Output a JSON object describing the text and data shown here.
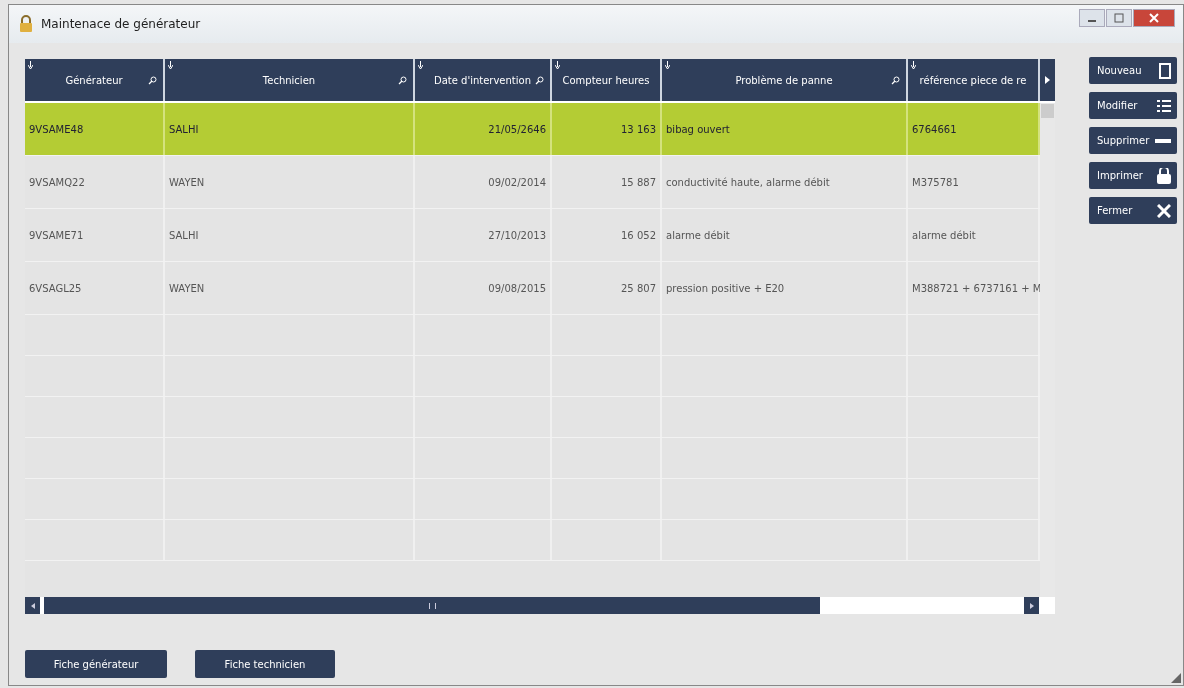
{
  "window": {
    "title": "Maintenace de générateur"
  },
  "table": {
    "columns": [
      {
        "label": "Générateur",
        "kind": "text",
        "filter": true
      },
      {
        "label": "Technicien",
        "kind": "text",
        "filter": true
      },
      {
        "label": "Date d'intervention",
        "kind": "number",
        "filter": true
      },
      {
        "label": "Compteur heures",
        "kind": "number",
        "filter": false
      },
      {
        "label": "Problème de panne",
        "kind": "text",
        "filter": true
      },
      {
        "label": "référence piece de re",
        "kind": "text",
        "filter": false
      }
    ],
    "rows": [
      {
        "selected": true,
        "cells": [
          "9VSAME48",
          "SALHI",
          "21/05/2646",
          "13 163",
          "bibag ouvert",
          "6764661"
        ]
      },
      {
        "selected": false,
        "cells": [
          "9VSAMQ22",
          "WAYEN",
          "09/02/2014",
          "15 887",
          "conductivité haute, alarme débit",
          "M375781"
        ]
      },
      {
        "selected": false,
        "cells": [
          "9VSAME71",
          "SALHI",
          "27/10/2013",
          "16 052",
          "alarme débit",
          "alarme débit"
        ]
      },
      {
        "selected": false,
        "cells": [
          "6VSAGL25",
          "WAYEN",
          "09/08/2015",
          "25 807",
          "pression positive + E20",
          "M388721 + 6737161 + M"
        ]
      }
    ]
  },
  "side_buttons": [
    {
      "label": "Nouveau",
      "kind": "new"
    },
    {
      "label": "Modifier",
      "kind": "edit"
    },
    {
      "label": "Supprimer",
      "kind": "delete"
    },
    {
      "label": "Imprimer",
      "kind": "print"
    },
    {
      "label": "Fermer",
      "kind": "close"
    }
  ],
  "bottom_buttons": [
    "Fiche générateur",
    "Fiche technicien"
  ]
}
